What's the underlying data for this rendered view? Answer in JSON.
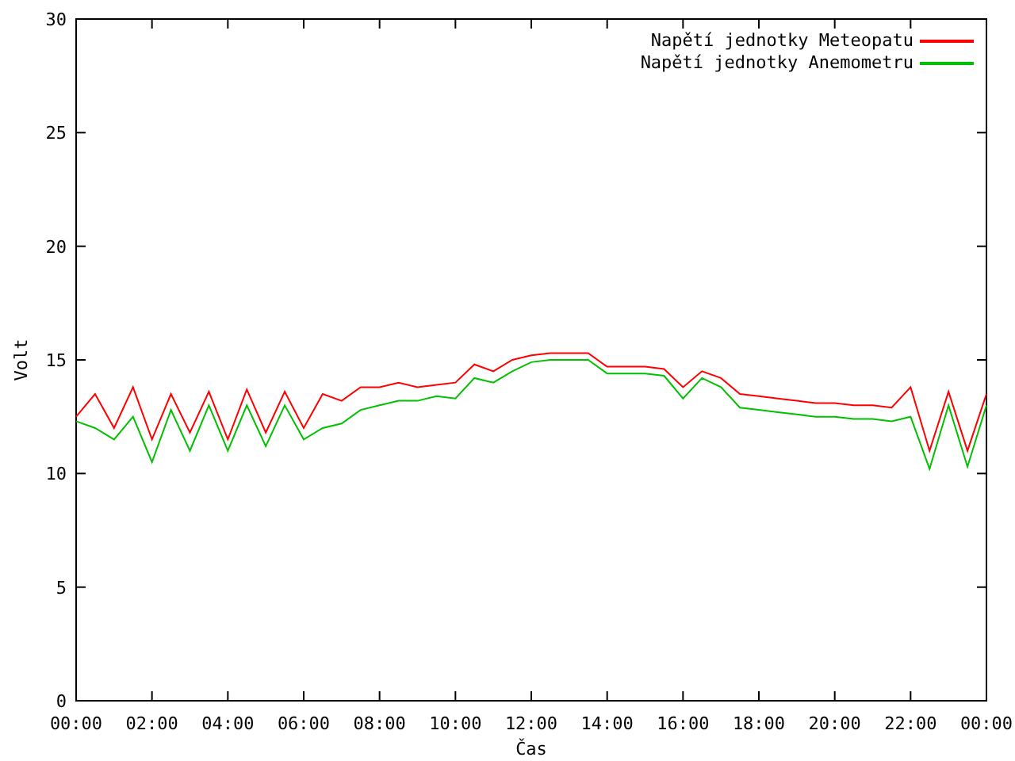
{
  "chart": {
    "chart_data": {
      "type": "line",
      "legend": true,
      "xlabel": "Čas",
      "ylabel": "Volt",
      "xlim": [
        0,
        24
      ],
      "ylim": [
        0,
        30
      ],
      "xticks": [
        {
          "value": 0,
          "label": "00:00"
        },
        {
          "value": 2,
          "label": "02:00"
        },
        {
          "value": 4,
          "label": "04:00"
        },
        {
          "value": 6,
          "label": "06:00"
        },
        {
          "value": 8,
          "label": "08:00"
        },
        {
          "value": 10,
          "label": "10:00"
        },
        {
          "value": 12,
          "label": "12:00"
        },
        {
          "value": 14,
          "label": "14:00"
        },
        {
          "value": 16,
          "label": "16:00"
        },
        {
          "value": 18,
          "label": "18:00"
        },
        {
          "value": 20,
          "label": "20:00"
        },
        {
          "value": 22,
          "label": "22:00"
        },
        {
          "value": 24,
          "label": "00:00"
        }
      ],
      "yticks": [
        0,
        5,
        10,
        15,
        20,
        25,
        30
      ],
      "x": [
        0,
        0.5,
        1,
        1.5,
        2,
        2.5,
        3,
        3.5,
        4,
        4.5,
        5,
        5.5,
        6,
        6.5,
        7,
        7.5,
        8,
        8.5,
        9,
        9.5,
        10,
        10.5,
        11,
        11.5,
        12,
        12.5,
        13,
        13.5,
        14,
        14.5,
        15,
        15.5,
        16,
        16.5,
        17,
        17.5,
        18,
        18.5,
        19,
        19.5,
        20,
        20.5,
        21,
        21.5,
        22,
        22.5,
        23,
        23.5,
        24
      ],
      "series": [
        {
          "name": "Napětí jednotky Meteopatu",
          "color": "#ff0000",
          "values": [
            12.5,
            13.5,
            12,
            13.8,
            11.5,
            13.5,
            11.8,
            13.6,
            11.5,
            13.7,
            11.8,
            13.6,
            12,
            13.5,
            13.2,
            13.8,
            13.8,
            14,
            13.8,
            13.9,
            14,
            14.8,
            14.5,
            15,
            15.2,
            15.3,
            15.3,
            15.3,
            14.7,
            14.7,
            14.7,
            14.6,
            13.8,
            14.5,
            14.2,
            13.5,
            13.4,
            13.3,
            13.2,
            13.1,
            13.1,
            13,
            13,
            12.9,
            13.8,
            11,
            13.6,
            11,
            13.5
          ]
        },
        {
          "name": "Napětí jednotky Anemometru",
          "color": "#00c000",
          "values": [
            12.3,
            12,
            11.5,
            12.5,
            10.5,
            12.8,
            11,
            13,
            11,
            13,
            11.2,
            13,
            11.5,
            12,
            12.2,
            12.8,
            13,
            13.2,
            13.2,
            13.4,
            13.3,
            14.2,
            14,
            14.5,
            14.9,
            15,
            15,
            15,
            14.4,
            14.4,
            14.4,
            14.3,
            13.3,
            14.2,
            13.8,
            12.9,
            12.8,
            12.7,
            12.6,
            12.5,
            12.5,
            12.4,
            12.4,
            12.3,
            12.5,
            10.2,
            13,
            10.3,
            13
          ]
        }
      ]
    }
  }
}
